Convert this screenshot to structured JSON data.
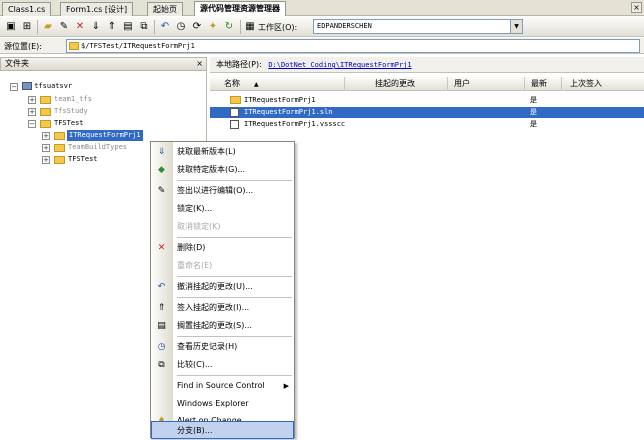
{
  "tabs": [
    {
      "label": "Class1.cs"
    },
    {
      "label": "Form1.cs [设计]"
    },
    {
      "label": "起始页"
    },
    {
      "label": "源代码管理资源管理器"
    }
  ],
  "toolbar": {
    "workspace_label": "工作区(O):",
    "workspace_value": "EDPANDERSCHEN"
  },
  "source_location": {
    "label": "源位置(E):",
    "path": "$/TFSTest/ITRequestFormPrj1"
  },
  "left_pane": {
    "title": "文件夹",
    "close": "×"
  },
  "tree": {
    "root": "tfsuatsvr",
    "items": [
      {
        "label": "team1_tfs"
      },
      {
        "label": "TfsStudy"
      },
      {
        "label": "TFSTest"
      },
      {
        "label": "ITRequestFormPrj1"
      },
      {
        "label": "TeamBuildTypes"
      },
      {
        "label": "TFSTest"
      }
    ]
  },
  "local_path": {
    "label": "本地路径(P):",
    "path": "D:\\DotNet_Coding\\ITRequestFormPrj1"
  },
  "columns": [
    "名称",
    "挂起的更改",
    "用户",
    "最新",
    "上次签入"
  ],
  "files": [
    {
      "name": "ITRequestFormPrj1",
      "latest": "是"
    },
    {
      "name": "ITRequestFormPrj1.sln",
      "latest": "是"
    },
    {
      "name": "ITRequestFormPrj1.vssscc",
      "latest": "是"
    }
  ],
  "context_menu": {
    "items": [
      {
        "label": "获取最新版本(L)"
      },
      {
        "label": "获取特定版本(G)..."
      },
      {
        "label": "签出以进行编辑(O)..."
      },
      {
        "label": "锁定(K)..."
      },
      {
        "label": "取消锁定(K)"
      },
      {
        "label": "删除(D)"
      },
      {
        "label": "重命名(E)"
      },
      {
        "label": "撤消挂起的更改(U)..."
      },
      {
        "label": "签入挂起的更改(I)..."
      },
      {
        "label": "搁置挂起的更改(S)..."
      },
      {
        "label": "查看历史记录(H)"
      },
      {
        "label": "比较(C)..."
      },
      {
        "label": "Find in Source Control"
      },
      {
        "label": "Windows Explorer"
      },
      {
        "label": "Alert on Change..."
      },
      {
        "label": "分支(B)..."
      }
    ]
  },
  "colors": {
    "selection": "#316ac5",
    "highlight": "#c1d2ee",
    "folder": "#f2c94c",
    "link": "#0000cc"
  }
}
